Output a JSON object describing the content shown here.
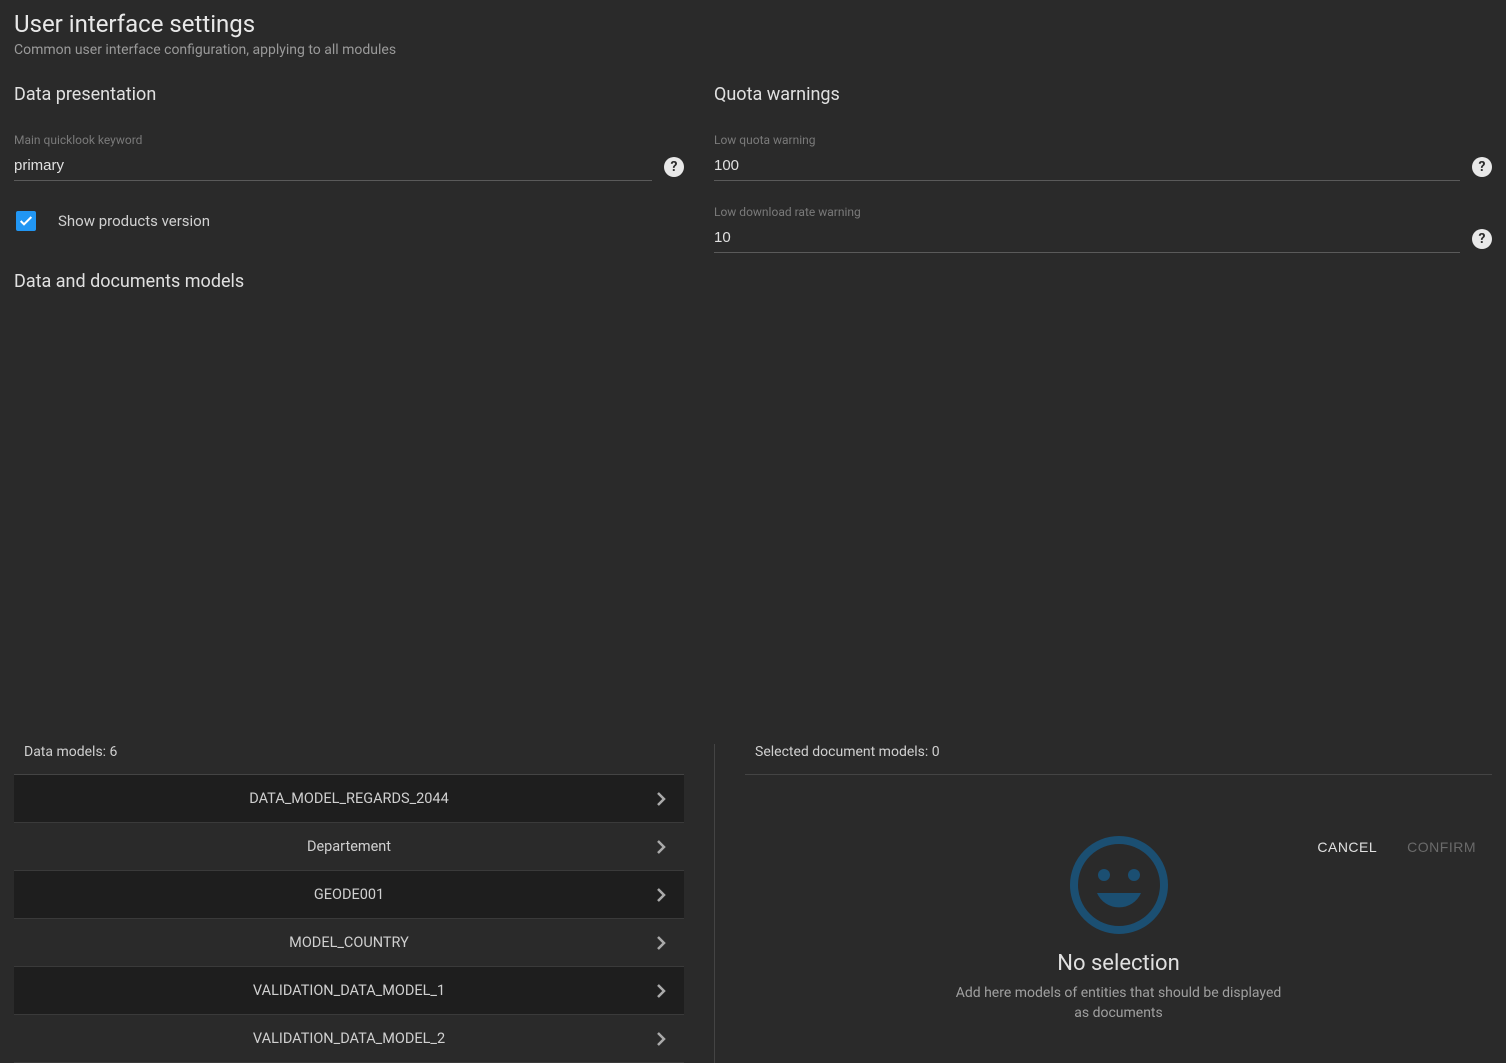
{
  "header": {
    "title": "User interface settings",
    "subtitle": "Common user interface configuration, applying to all modules"
  },
  "dataPresentation": {
    "title": "Data presentation",
    "quicklook": {
      "label": "Main quicklook keyword",
      "value": "primary"
    },
    "showVersion": {
      "label": "Show products version",
      "checked": true
    }
  },
  "quotaWarnings": {
    "title": "Quota warnings",
    "lowQuota": {
      "label": "Low quota warning",
      "value": "100"
    },
    "lowRate": {
      "label": "Low download rate warning",
      "value": "10"
    }
  },
  "modelsSection": {
    "title": "Data and documents models",
    "dataModelsCount": "Data models: 6",
    "selectedDocsCount": "Selected document models: 0",
    "dataModels": [
      "DATA_MODEL_REGARDS_2044",
      "Departement",
      "GEODE001",
      "MODEL_COUNTRY",
      "VALIDATION_DATA_MODEL_1",
      "VALIDATION_DATA_MODEL_2"
    ],
    "empty": {
      "title": "No selection",
      "subtitle": "Add here models of entities that should be displayed as documents"
    }
  },
  "footer": {
    "cancel": "CANCEL",
    "confirm": "CONFIRM"
  }
}
